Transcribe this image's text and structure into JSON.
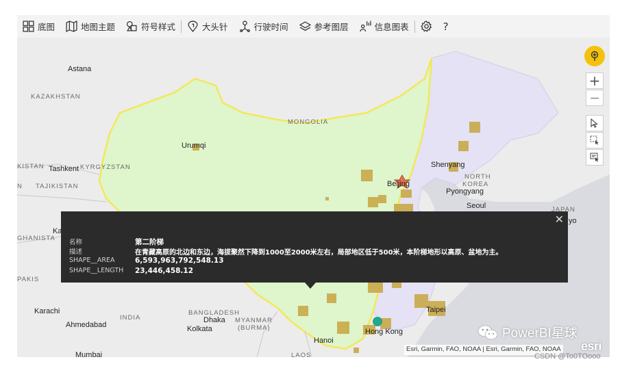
{
  "toolbar": {
    "items": [
      {
        "label": "底图",
        "icon": "basemap-grid-icon"
      },
      {
        "label": "地图主题",
        "icon": "map-theme-icon"
      },
      {
        "label": "符号样式",
        "icon": "symbol-style-icon"
      },
      {
        "label": "大头针",
        "icon": "pin-icon"
      },
      {
        "label": "行驶时间",
        "icon": "drive-time-icon"
      },
      {
        "label": "参考图层",
        "icon": "reference-layers-icon"
      },
      {
        "label": "信息图表",
        "icon": "infographics-icon"
      }
    ],
    "settings_icon": "gear-icon",
    "help_label": "?"
  },
  "map_labels": {
    "astana": "Astana",
    "kazakhstan": "KAZAKHSTAN",
    "mongolia": "MONGOLIA",
    "urumqi": "Urumqi",
    "kistan": "KISTAN",
    "tashkent": "Tashkent",
    "kyrgyzstan": "KYRGYZSTAN",
    "tajikistan": "TAJIKISTAN",
    "n_edge": "N",
    "shenyang": "Shenyang",
    "north_korea_1": "NORTH",
    "north_korea_2": "KOREA",
    "pyongyang": "Pyongyang",
    "beijing": "Beijing",
    "seoul": "Seoul",
    "ghanista": "GHANISTA",
    "ka": "Ka",
    "pakis": "PAKIS",
    "japan": "JAPAN",
    "tokyo": "yo",
    "karachi": "Karachi",
    "india": "INDIA",
    "ahmedabad": "Ahmedabad",
    "bangladesh": "BANGLADESH",
    "dhaka": "Dhaka",
    "myanmar": "MYANMAR",
    "burma": "(BURMA)",
    "kolkata": "Kolkata",
    "hanoi": "Hanoi",
    "hongkong": "Hong Kong",
    "taipei": "Taipei",
    "mumbai": "Mumbai",
    "laos": "LAOS"
  },
  "tooltip": {
    "rows": [
      {
        "key": "名称",
        "value": "第二阶梯"
      },
      {
        "key": "描述",
        "value": "在青藏高原的北边和东边，海拔聚然下降到1000至2000米左右，局部地区低于500米，本阶梯地形以高原、盆地为主。"
      },
      {
        "key": "SHAPE__AREA",
        "value": "6,593,963,792,548.13"
      },
      {
        "key": "SHAPE__LENGTH",
        "value": "23,446,458.12"
      }
    ],
    "close_label": "✕"
  },
  "controls": {
    "zoom_in": "+",
    "zoom_out": "—"
  },
  "attribution": "Esri, Garmin, FAO, NOAA | Esri, Garmin, FAO, NOAA",
  "esri_logo": "esri",
  "watermark": "PowerBI星球",
  "csdn": "CSDN @To0TOooo",
  "colors": {
    "region_fill": "#dff5cc",
    "region_stroke": "#f2e85a",
    "east_fill": "#e4e2f4",
    "marker": "#c9a949",
    "locate_button": "#f4c20d",
    "tooltip_bg": "#2b2b2b"
  }
}
